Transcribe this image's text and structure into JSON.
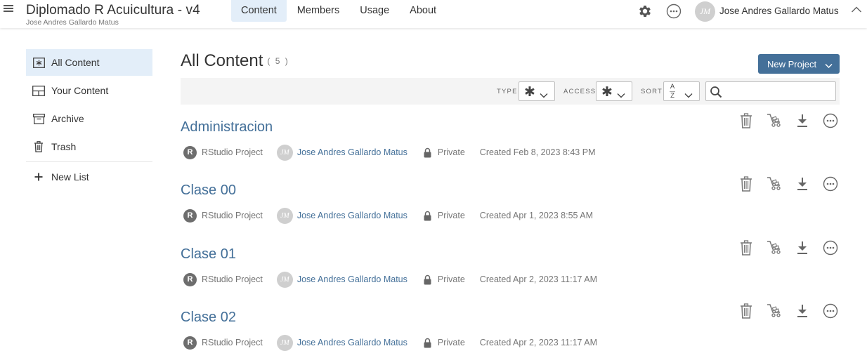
{
  "header": {
    "space_title": "Diplomado R Acuicultura - v4",
    "space_owner": "Jose Andres Gallardo Matus",
    "tabs": [
      {
        "label": "Content",
        "active": true
      },
      {
        "label": "Members",
        "active": false
      },
      {
        "label": "Usage",
        "active": false
      },
      {
        "label": "About",
        "active": false
      }
    ],
    "user": {
      "initials": "JM",
      "name": "Jose Andres Gallardo Matus"
    }
  },
  "sidebar": {
    "items": [
      {
        "label": "All Content",
        "icon": "asterisk-box-icon",
        "active": true
      },
      {
        "label": "Your Content",
        "icon": "grid-box-icon",
        "active": false
      },
      {
        "label": "Archive",
        "icon": "archive-box-icon",
        "active": false
      },
      {
        "label": "Trash",
        "icon": "trash-icon",
        "active": false
      }
    ],
    "new_list_label": "New List"
  },
  "main": {
    "title": "All Content",
    "count": "( 5 )",
    "new_project_label": "New Project"
  },
  "filters": {
    "type_label": "TYPE",
    "access_label": "ACCESS",
    "sort_label": "SORT",
    "type_value": "✱",
    "access_value": "✱",
    "sort_top": "A",
    "sort_bottom": "Z",
    "search_placeholder": ""
  },
  "projects": [
    {
      "title": "Administracion",
      "type_badge": "R",
      "type": "RStudio Project",
      "owner_initials": "JM",
      "owner": "Jose Andres Gallardo Matus",
      "access": "Private",
      "created": "Created Feb 8, 2023 8:43 PM"
    },
    {
      "title": "Clase 00",
      "type_badge": "R",
      "type": "RStudio Project",
      "owner_initials": "JM",
      "owner": "Jose Andres Gallardo Matus",
      "access": "Private",
      "created": "Created Apr 1, 2023 8:55 AM"
    },
    {
      "title": "Clase 01",
      "type_badge": "R",
      "type": "RStudio Project",
      "owner_initials": "JM",
      "owner": "Jose Andres Gallardo Matus",
      "access": "Private",
      "created": "Created Apr 2, 2023 11:17 AM"
    },
    {
      "title": "Clase 02",
      "type_badge": "R",
      "type": "RStudio Project",
      "owner_initials": "JM",
      "owner": "Jose Andres Gallardo Matus",
      "access": "Private",
      "created": "Created Apr 2, 2023 11:17 AM"
    }
  ],
  "colors": {
    "accent": "#447099",
    "active_bg": "#e3eef9",
    "filter_bg": "#f4f4f4"
  }
}
